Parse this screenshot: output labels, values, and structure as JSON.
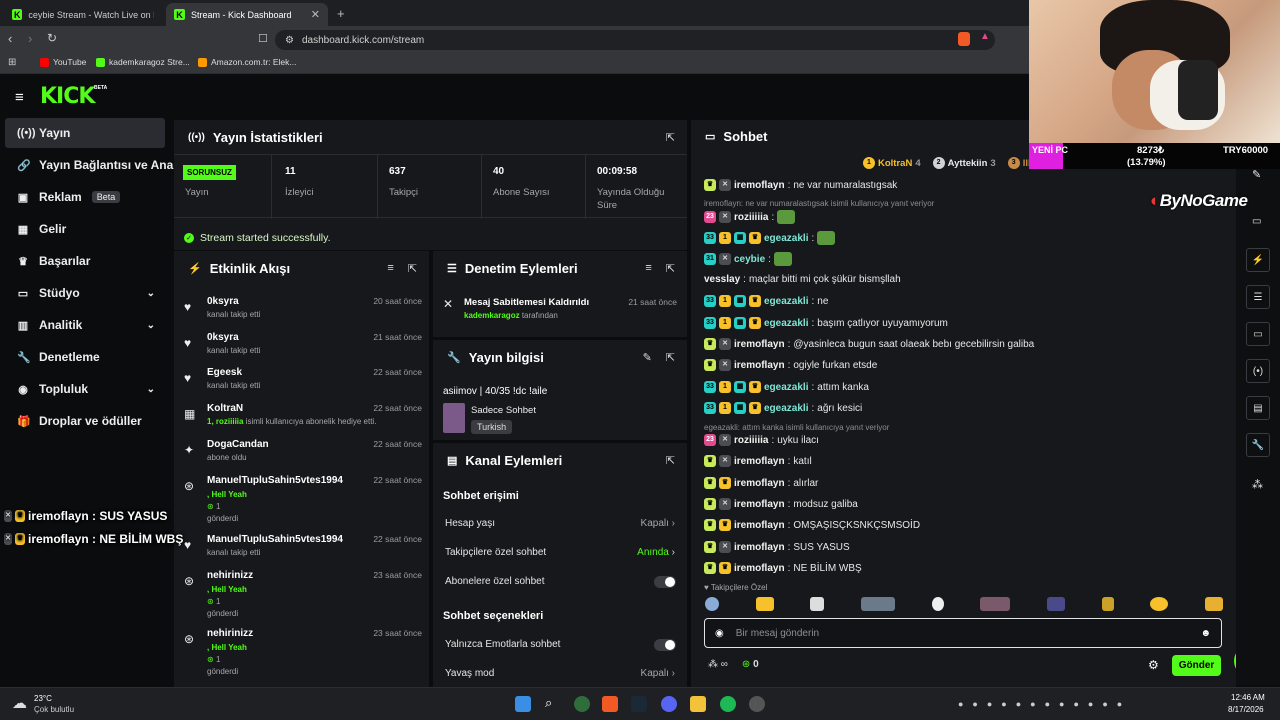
{
  "browser": {
    "tabs": [
      {
        "title": "ceybie Stream - Watch Live on Ki"
      },
      {
        "title": "Stream - Kick Dashboard"
      }
    ],
    "url": "dashboard.kick.com/stream",
    "bookmarks": [
      "YouTube",
      "kademkaragoz Stre...",
      "Amazon.com.tr: Elek..."
    ]
  },
  "brand": {
    "logo": "KICK",
    "beta": "BETA",
    "accent": "#53fc18"
  },
  "sidebar": {
    "items": [
      {
        "label": "Yayın",
        "icon": "broadcast-icon",
        "badge": ""
      },
      {
        "label": "Yayın Bağlantısı ve Anahtar",
        "icon": "link-icon",
        "badge": ""
      },
      {
        "label": "Reklam",
        "icon": "ad-icon",
        "badge": "Beta"
      },
      {
        "label": "Gelir",
        "icon": "money-icon",
        "badge": ""
      },
      {
        "label": "Başarılar",
        "icon": "trophy-icon",
        "badge": ""
      },
      {
        "label": "Stüdyo",
        "icon": "studio-icon",
        "badge": ""
      },
      {
        "label": "Analitik",
        "icon": "chart-icon",
        "badge": ""
      },
      {
        "label": "Denetleme",
        "icon": "wrench-icon",
        "badge": ""
      },
      {
        "label": "Topluluk",
        "icon": "community-icon",
        "badge": ""
      },
      {
        "label": "Droplar ve ödüller",
        "icon": "gift-icon",
        "badge": ""
      }
    ]
  },
  "stats": {
    "title": "Yayın İstatistikleri",
    "status_badge": "SORUNSUZ",
    "items": [
      {
        "value": "",
        "label": "Yayın"
      },
      {
        "value": "11",
        "label": "İzleyici"
      },
      {
        "value": "637",
        "label": "Takipçi"
      },
      {
        "value": "40",
        "label": "Abone Sayısı"
      },
      {
        "value": "00:09:58",
        "label": "Yayında Olduğu Süre"
      }
    ],
    "success_message": "Stream started successfully."
  },
  "activity": {
    "title": "Etkinlik Akışı",
    "events": [
      {
        "name": "0ksyra",
        "time": "20 saat önce",
        "sub": "kanalı takip etti",
        "icon": "heart-icon"
      },
      {
        "name": "0ksyra",
        "time": "21 saat önce",
        "sub": "kanalı takip etti",
        "icon": "heart-icon"
      },
      {
        "name": "Egeesk",
        "time": "22 saat önce",
        "sub": "kanalı takip etti",
        "icon": "heart-icon"
      },
      {
        "name": "KoltraN",
        "time": "22 saat önce",
        "sub_highlight": "1, roziiiiia",
        "sub": " isimli kullanıcıya abonelik hediye etti.",
        "icon": "gift-icon"
      },
      {
        "name": "DogaCandan",
        "time": "22 saat önce",
        "sub": "abone oldu",
        "icon": "sparkle-icon"
      },
      {
        "name": "ManuelTupluSahin5vtes1994",
        "time": "22 saat önce",
        "sub_highlight": ", Hell Yeah",
        "count": "1",
        "sub": "gönderdi",
        "icon": "kicks-icon"
      },
      {
        "name": "ManuelTupluSahin5vtes1994",
        "time": "22 saat önce",
        "sub": "kanalı takip etti",
        "icon": "heart-icon"
      },
      {
        "name": "nehirinizz",
        "time": "23 saat önce",
        "sub_highlight": ", Hell Yeah",
        "count": "1",
        "sub": "gönderdi",
        "icon": "kicks-icon"
      },
      {
        "name": "nehirinizz",
        "time": "23 saat önce",
        "sub_highlight": ", Hell Yeah",
        "count": "1",
        "sub": "gönderdi",
        "icon": "kicks-icon"
      }
    ]
  },
  "moderation": {
    "title": "Denetim Eylemleri",
    "item": {
      "action": "Mesaj Sabitlemesi Kaldırıldı",
      "time": "21 saat önce",
      "user": "kademkaragoz",
      "suffix": " tarafından"
    }
  },
  "streaminfo": {
    "title": "Yayın bilgisi",
    "stream_title": "asiimov | 40/35 !dc !aile",
    "category": "Sadece Sohbet",
    "tag": "Turkish"
  },
  "channel_actions": {
    "title": "Kanal Eylemleri",
    "section1": "Sohbet erişimi",
    "rows1": [
      {
        "label": "Hesap yaşı",
        "value": "Kapalı"
      },
      {
        "label": "Takipçilere özel sohbet",
        "value": "Anında"
      },
      {
        "label": "Abonelere özel sohbet",
        "value": ""
      }
    ],
    "section2": "Sohbet seçenekleri",
    "rows2": [
      {
        "label": "Yalnızca Emotlarla sohbet",
        "value": ""
      },
      {
        "label": "Yavaş mod",
        "value": "Kapalı"
      }
    ]
  },
  "chat": {
    "title": "Sohbet",
    "leaderboard": [
      {
        "rank": "1",
        "name": "KoltraN",
        "count": "4"
      },
      {
        "rank": "2",
        "name": "Ayttekiin",
        "count": "3"
      },
      {
        "rank": "3",
        "name": "Ill...",
        "count": ""
      }
    ],
    "messages": [
      {
        "user": "iremoflayn",
        "text": "ne var numaralastıgsak",
        "badges": [
          "sub",
          "sw"
        ],
        "style": "normal"
      },
      {
        "reply": "iremoflayn: ne var numaralastıgsak isimli kullanıcıya yanıt veriyor"
      },
      {
        "user": "roziiiiia",
        "text": "",
        "badges": [
          "pink23",
          "sw"
        ],
        "style": "normal",
        "emote": true
      },
      {
        "user": "egeazakli",
        "text": "",
        "badges": [
          "cyan33",
          "gold",
          "cyan2",
          "gold2"
        ],
        "style": "g",
        "emote": true
      },
      {
        "user": "ceybie",
        "text": "",
        "badges": [
          "cyan31",
          "sw"
        ],
        "style": "g",
        "emote": true
      },
      {
        "user": "vesslay",
        "text": "maçlar bitti mi çok şükür bismşllah",
        "badges": [],
        "style": "normal"
      },
      {
        "user": "egeazakli",
        "text": "ne",
        "badges": [
          "cyan33",
          "gold",
          "cyan2",
          "gold2"
        ],
        "style": "g"
      },
      {
        "user": "egeazakli",
        "text": "başım çatlıyor uyuyamıyorum",
        "badges": [
          "cyan33",
          "gold",
          "cyan2",
          "gold2"
        ],
        "style": "g"
      },
      {
        "user": "iremoflayn",
        "text": "@yasinleca bugun saat olaeak bebı gecebilirsin galiba",
        "badges": [
          "sub",
          "sw"
        ],
        "style": "normal"
      },
      {
        "user": "iremoflayn",
        "text": "ogiyle furkan etsde",
        "badges": [
          "sub",
          "sw"
        ],
        "style": "normal"
      },
      {
        "user": "egeazakli",
        "text": "attım kanka",
        "badges": [
          "cyan33",
          "gold",
          "cyan2",
          "gold2"
        ],
        "style": "g"
      },
      {
        "user": "egeazakli",
        "text": "ağrı kesici",
        "badges": [
          "cyan33",
          "gold",
          "cyan2",
          "gold2"
        ],
        "style": "g"
      },
      {
        "reply": "egeazakli: attım kanka isimli kullanıcıya yanıt veriyor"
      },
      {
        "user": "roziiiiia",
        "text": "uyku ilacı",
        "badges": [
          "pink23",
          "sw"
        ],
        "style": "normal"
      },
      {
        "user": "iremoflayn",
        "text": "katıl",
        "badges": [
          "sub",
          "sw"
        ],
        "style": "normal"
      },
      {
        "user": "iremoflayn",
        "text": "alırlar",
        "badges": [
          "sub",
          "gold2"
        ],
        "style": "normal"
      },
      {
        "user": "iremoflayn",
        "text": "modsuz galiba",
        "badges": [
          "sub",
          "sw"
        ],
        "style": "normal"
      },
      {
        "user": "iremoflayn",
        "text": "OMŞAŞISÇKSNKÇSMSOİD",
        "badges": [
          "sub",
          "gold2"
        ],
        "style": "normal"
      },
      {
        "user": "iremoflayn",
        "text": "SUS YASUS",
        "badges": [
          "sub",
          "sw"
        ],
        "style": "normal"
      },
      {
        "user": "iremoflayn",
        "text": "NE BİLİM WBŞ",
        "badges": [
          "sub",
          "gold2"
        ],
        "style": "normal"
      }
    ],
    "followers_only": "Takipçilere Özel",
    "input_placeholder": "Bir mesaj gönderin",
    "kicks_count": "0",
    "send_label": "Gönder"
  },
  "overlay": {
    "brand": "ByNoGame",
    "bar_label": "YENİ PC",
    "bar_value": "8273₺",
    "bar_pct": "(13.79%)",
    "bar_goal": "TRY60000",
    "lines": [
      "iremoflayn : SUS YASUS",
      "iremoflayn : NE BİLİM WBŞ"
    ]
  },
  "taskbar": {
    "weather_temp": "23°C",
    "weather_desc": "Çok bulutlu",
    "time": "12:46 AM",
    "date": "8/17/2026"
  }
}
